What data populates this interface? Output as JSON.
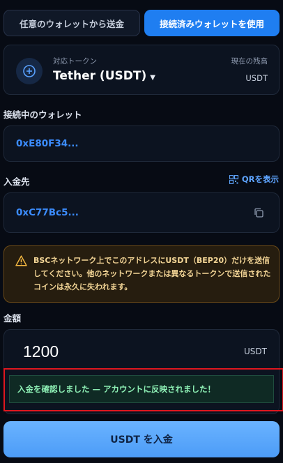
{
  "tabs": {
    "send_from_any": "任意のウォレットから送金",
    "use_connected": "接続済みウォレットを使用"
  },
  "token": {
    "label": "対応トークン",
    "name": "Tether (USDT)",
    "balance_label": "現在の残高",
    "balance_unit": "USDT"
  },
  "wallet": {
    "label": "接続中のウォレット",
    "address": "0xE80F34..."
  },
  "deposit_to": {
    "label": "入金先",
    "qr_label": "QRを表示",
    "address": "0xC77Bc5..."
  },
  "warning": {
    "text": "BSCネットワーク上でこのアドレスにUSDT（BEP20）だけを送信してください。他のネットワークまたは異なるトークンで送信されたコインは永久に失われます。"
  },
  "amount": {
    "label": "金額",
    "value": "1200",
    "unit": "USDT"
  },
  "status": {
    "message": "入金を確認しました — アカウントに反映されました！"
  },
  "actions": {
    "deposit_label": "USDT を入金"
  },
  "colors": {
    "accent": "#1f7ef1",
    "address": "#3c8dff",
    "warning_bg": "#261d0f",
    "success_text": "#8ef0b5",
    "highlight": "#e0171f"
  },
  "icons": {
    "token": "plus-circle-icon",
    "qr": "qr-code-icon",
    "copy": "copy-icon",
    "warning": "warning-triangle-icon"
  }
}
